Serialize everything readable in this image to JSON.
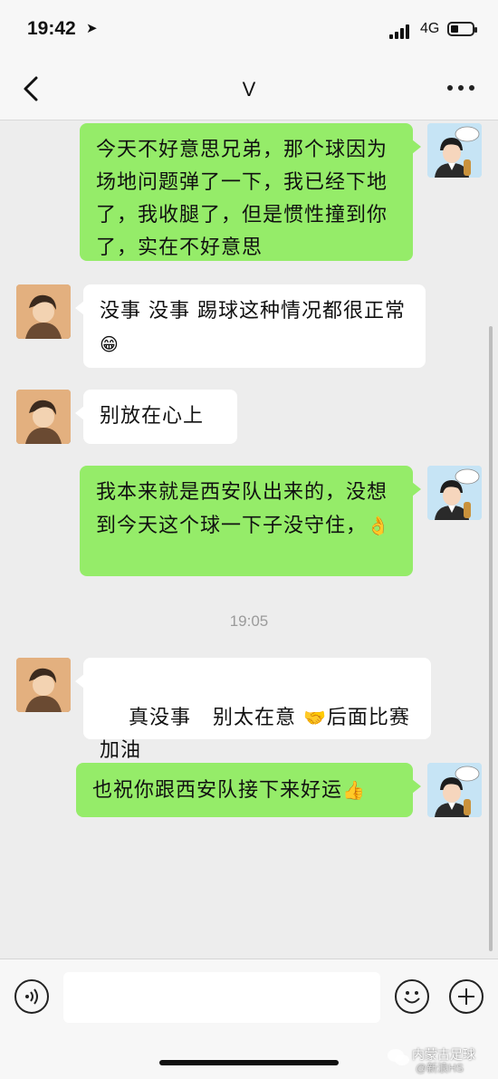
{
  "status": {
    "time": "19:42",
    "network": "4G"
  },
  "nav": {
    "title": "V"
  },
  "messages": [
    {
      "from": "me",
      "text": "今天不好意思兄弟，那个球因为场地问题弹了一下，我已经下地了，我收腿了，但是惯性撞到你了，实在不好意思"
    },
    {
      "from": "other",
      "text": "没事 没事 踢球这种情况都很正常",
      "emoji": "😁"
    },
    {
      "from": "other",
      "text": "别放在心上"
    },
    {
      "from": "me",
      "text": "我本来就是西安队出来的，没想到今天这个球一下子没守住，",
      "emoji": "👌"
    },
    {
      "from": "other",
      "text": "  真没事   别太在意 ",
      "emoji": "🤝",
      "text2": "后面比赛加油"
    },
    {
      "from": "me",
      "text": "也祝你跟西安队接下来好运",
      "emoji": "👍"
    }
  ],
  "timestamp": "19:05",
  "input": {
    "placeholder": ""
  },
  "watermark": {
    "title": "内蒙古足球",
    "handle": "@新浪HS"
  }
}
